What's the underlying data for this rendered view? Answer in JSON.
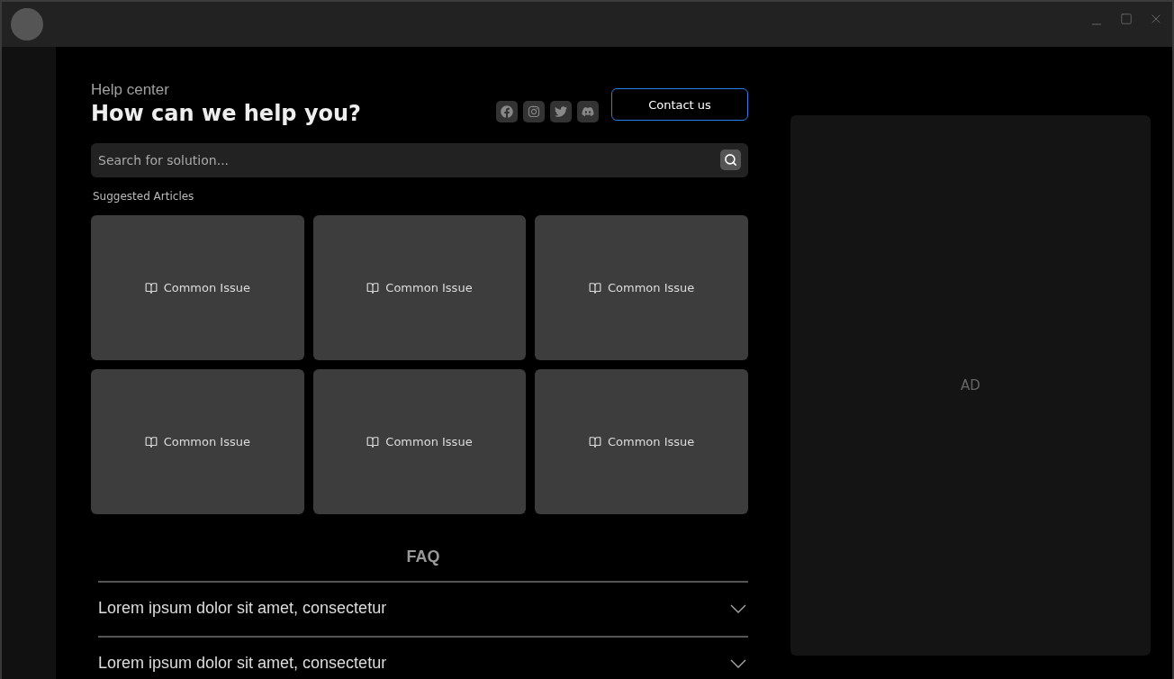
{
  "header": {
    "eyebrow": "Help center",
    "title": "How can we help you?",
    "contact_button": "Contact us"
  },
  "social": [
    {
      "kind": "facebook"
    },
    {
      "kind": "instagram"
    },
    {
      "kind": "twitter"
    },
    {
      "kind": "discord"
    }
  ],
  "search": {
    "placeholder": "Search for solution..."
  },
  "suggested": {
    "label": "Suggested Articles",
    "articles": [
      {
        "title": "Common Issue"
      },
      {
        "title": "Common Issue"
      },
      {
        "title": "Common Issue"
      },
      {
        "title": "Common Issue"
      },
      {
        "title": "Common Issue"
      },
      {
        "title": "Common Issue"
      }
    ]
  },
  "faq": {
    "title": "FAQ",
    "items": [
      {
        "question": "Lorem ipsum dolor sit amet, consectetur",
        "expanded": false
      },
      {
        "question": "Lorem ipsum dolor sit amet, consectetur",
        "expanded": false
      }
    ]
  },
  "ad": {
    "label": "AD"
  }
}
